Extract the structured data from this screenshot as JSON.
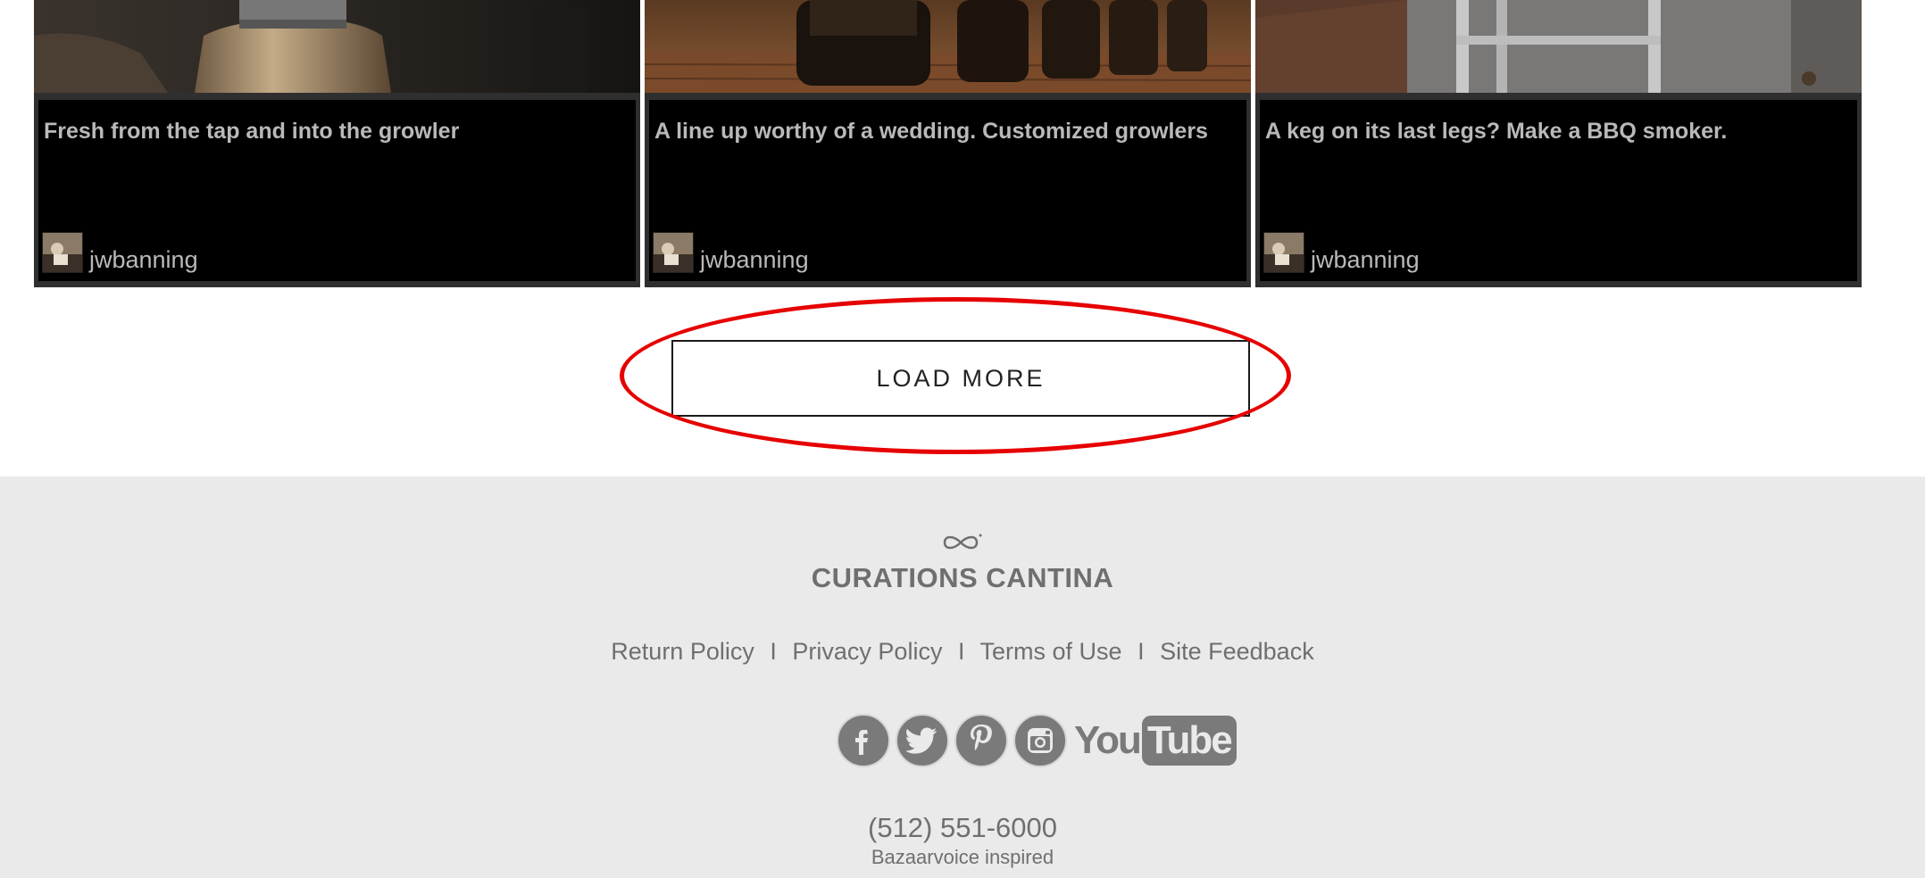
{
  "cards": [
    {
      "caption": "Fresh from the tap and into the growler",
      "username": "jwbanning",
      "image": "growler-bottle-photo"
    },
    {
      "caption": "A line up worthy of a wedding. Customized growlers",
      "username": "jwbanning",
      "image": "growlers-lineup-photo"
    },
    {
      "caption": "A keg on its last legs? Make a BBQ smoker.",
      "username": "jwbanning",
      "image": "keg-smoker-photo"
    }
  ],
  "load_more": {
    "label": "LOAD MORE",
    "highlight_color": "#e60000"
  },
  "footer": {
    "brand_name": "CURATIONS CANTINA",
    "links": [
      "Return Policy",
      "Privacy Policy",
      "Terms of Use",
      "Site Feedback"
    ],
    "separator": "I",
    "social": [
      "facebook-icon",
      "twitter-icon",
      "pinterest-icon",
      "instagram-icon",
      "youtube-icon"
    ],
    "youtube_you": "You",
    "youtube_tube": "Tube",
    "phone": "(512) 551-6000",
    "tagline": "Bazaarvoice inspired"
  },
  "colors": {
    "footer_bg": "#eaeaea",
    "card_panel": "#000000",
    "caption_text": "#b9b9b9",
    "footer_text": "#6f6f6f"
  }
}
